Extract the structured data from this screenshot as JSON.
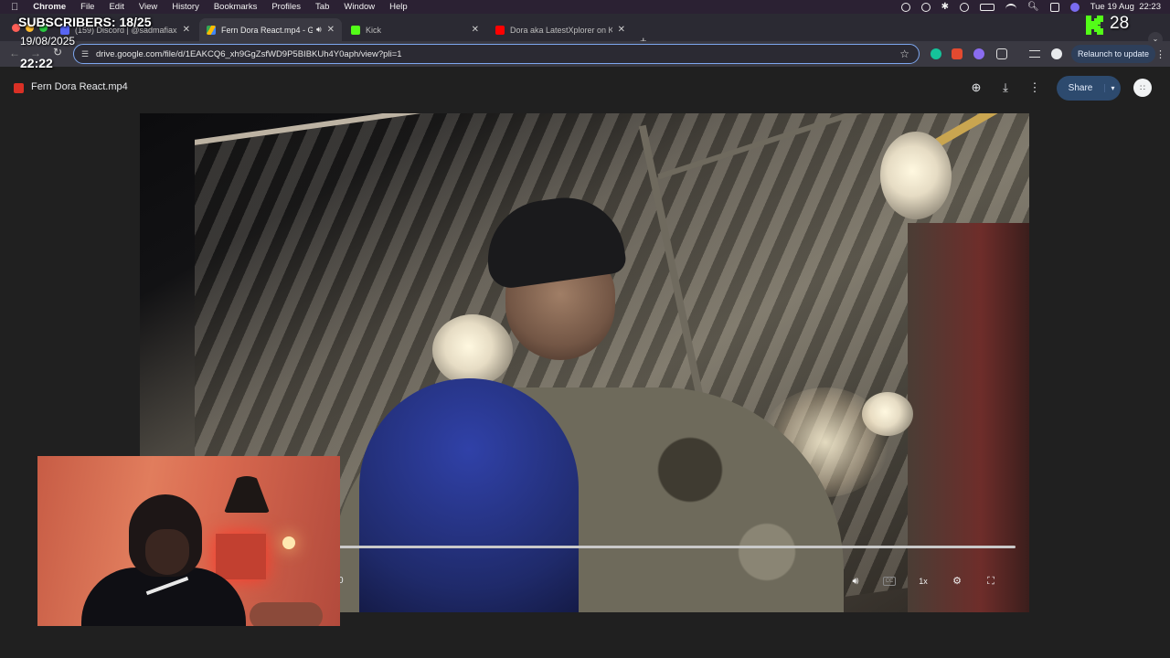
{
  "menubar": {
    "app": "Chrome",
    "items": [
      "File",
      "Edit",
      "View",
      "History",
      "Bookmarks",
      "Profiles",
      "Tab",
      "Window",
      "Help"
    ],
    "datetime": "Tue 19 Aug  22:23"
  },
  "tabs": [
    {
      "title": "(159) Discord | @sadmafiax",
      "favicon_color": "#5865f2"
    },
    {
      "title": "Fern Dora React.mp4 - Go",
      "favicon_color": "#34a853",
      "active": true
    },
    {
      "title": "Kick",
      "favicon_color": "#53fc18"
    },
    {
      "title": "Dora aka LatestXplorer on Ki",
      "favicon_color": "#ff0000"
    }
  ],
  "toolbar": {
    "url": "drive.google.com/file/d/1EAKCQ6_xh9GgZsfWD9P5BIBKUh4Y0aph/view?pli=1",
    "relaunch_label": "Relaunch to update"
  },
  "viewer": {
    "file_title": "Fern Dora React.mp4",
    "share_label": "Share"
  },
  "player": {
    "time_fragment": "0",
    "speed_label": "1x",
    "cc_label": "CC",
    "progress": 0
  },
  "overlay": {
    "subscribers": "SUBSCRIBERS: 18/25",
    "date": "19/08/2025",
    "time": "22:22",
    "kick_count": "28"
  },
  "colors": {
    "accent": "#7da7f0",
    "kick_green": "#53fc18",
    "share_bg": "#2d4a6e"
  }
}
